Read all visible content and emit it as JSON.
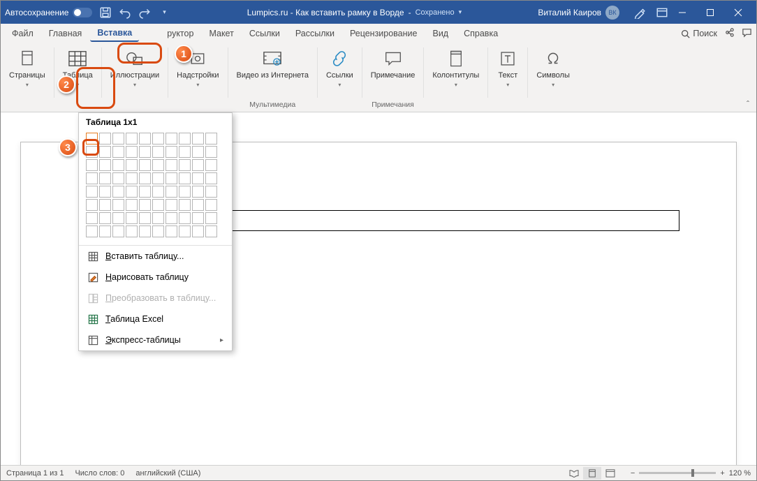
{
  "titlebar": {
    "autosave": "Автосохранение",
    "doc": "Lumpics.ru - Как вставить рамку в Ворде",
    "saved": "Сохранено",
    "user": "Виталий Каиров",
    "avatar": "ВК"
  },
  "tabs": {
    "file": "Файл",
    "home": "Главная",
    "insert": "Вставка",
    "design_suffix": "руктор",
    "layout": "Макет",
    "references": "Ссылки",
    "mailings": "Рассылки",
    "review": "Рецензирование",
    "view": "Вид",
    "help": "Справка",
    "search": "Поиск"
  },
  "ribbon": {
    "pages": "Страницы",
    "table": "Таблица",
    "illustrations": "Иллюстрации",
    "addins": "Надстройки",
    "video": "Видео из Интернета",
    "multimedia_group": "Мультимедиа",
    "links": "Ссылки",
    "comment": "Примечание",
    "comments_group": "Примечания",
    "headerfooter": "Колонтитулы",
    "text": "Текст",
    "symbols": "Символы"
  },
  "tabledd": {
    "header": "Таблица 1x1",
    "insert": "Вставить таблицу...",
    "draw": "Нарисовать таблицу",
    "convert": "Преобразовать в таблицу...",
    "excel": "Таблица Excel",
    "quick": "Экспресс-таблицы"
  },
  "status": {
    "page": "Страница 1 из 1",
    "words": "Число слов: 0",
    "lang": "английский (США)",
    "zoom": "120 %"
  },
  "callouts": {
    "c1": "1",
    "c2": "2",
    "c3": "3"
  }
}
